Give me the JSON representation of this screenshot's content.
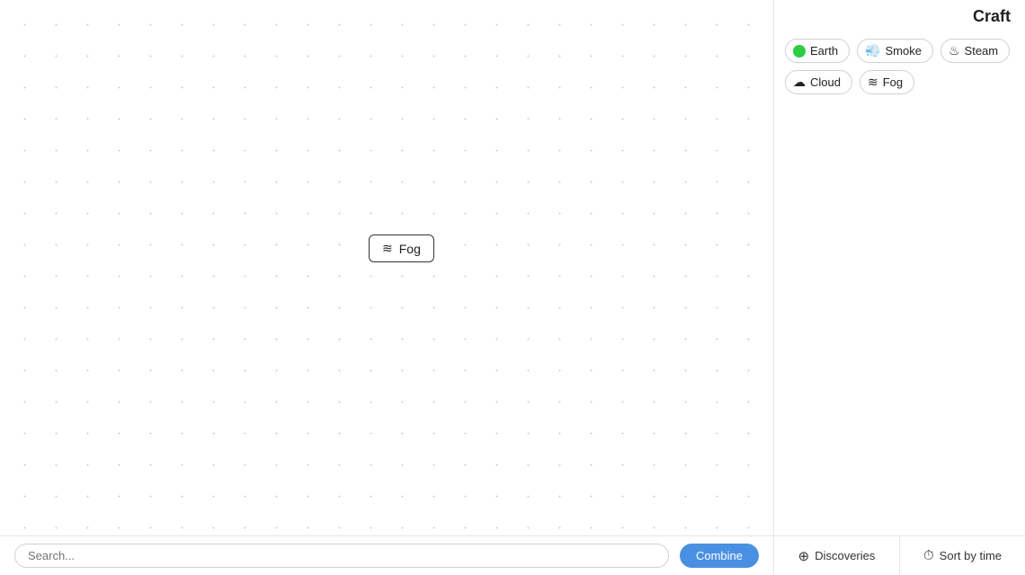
{
  "craft": {
    "title": "Craft"
  },
  "chips": [
    {
      "id": "earth",
      "label": "Earth",
      "icon": "earth"
    },
    {
      "id": "smoke",
      "label": "Smoke",
      "icon": "smoke"
    },
    {
      "id": "steam",
      "label": "Steam",
      "icon": "steam"
    },
    {
      "id": "cloud",
      "label": "Cloud",
      "icon": "cloud"
    },
    {
      "id": "fog",
      "label": "Fog",
      "icon": "fog"
    }
  ],
  "fog_node": {
    "label": "Fog",
    "icon": "≋"
  },
  "bottom_bar": {
    "discoveries_label": "Discoveries",
    "sort_label": "Sort by time"
  },
  "canvas": {
    "search_placeholder": "Search...",
    "combine_label": "Combine"
  }
}
